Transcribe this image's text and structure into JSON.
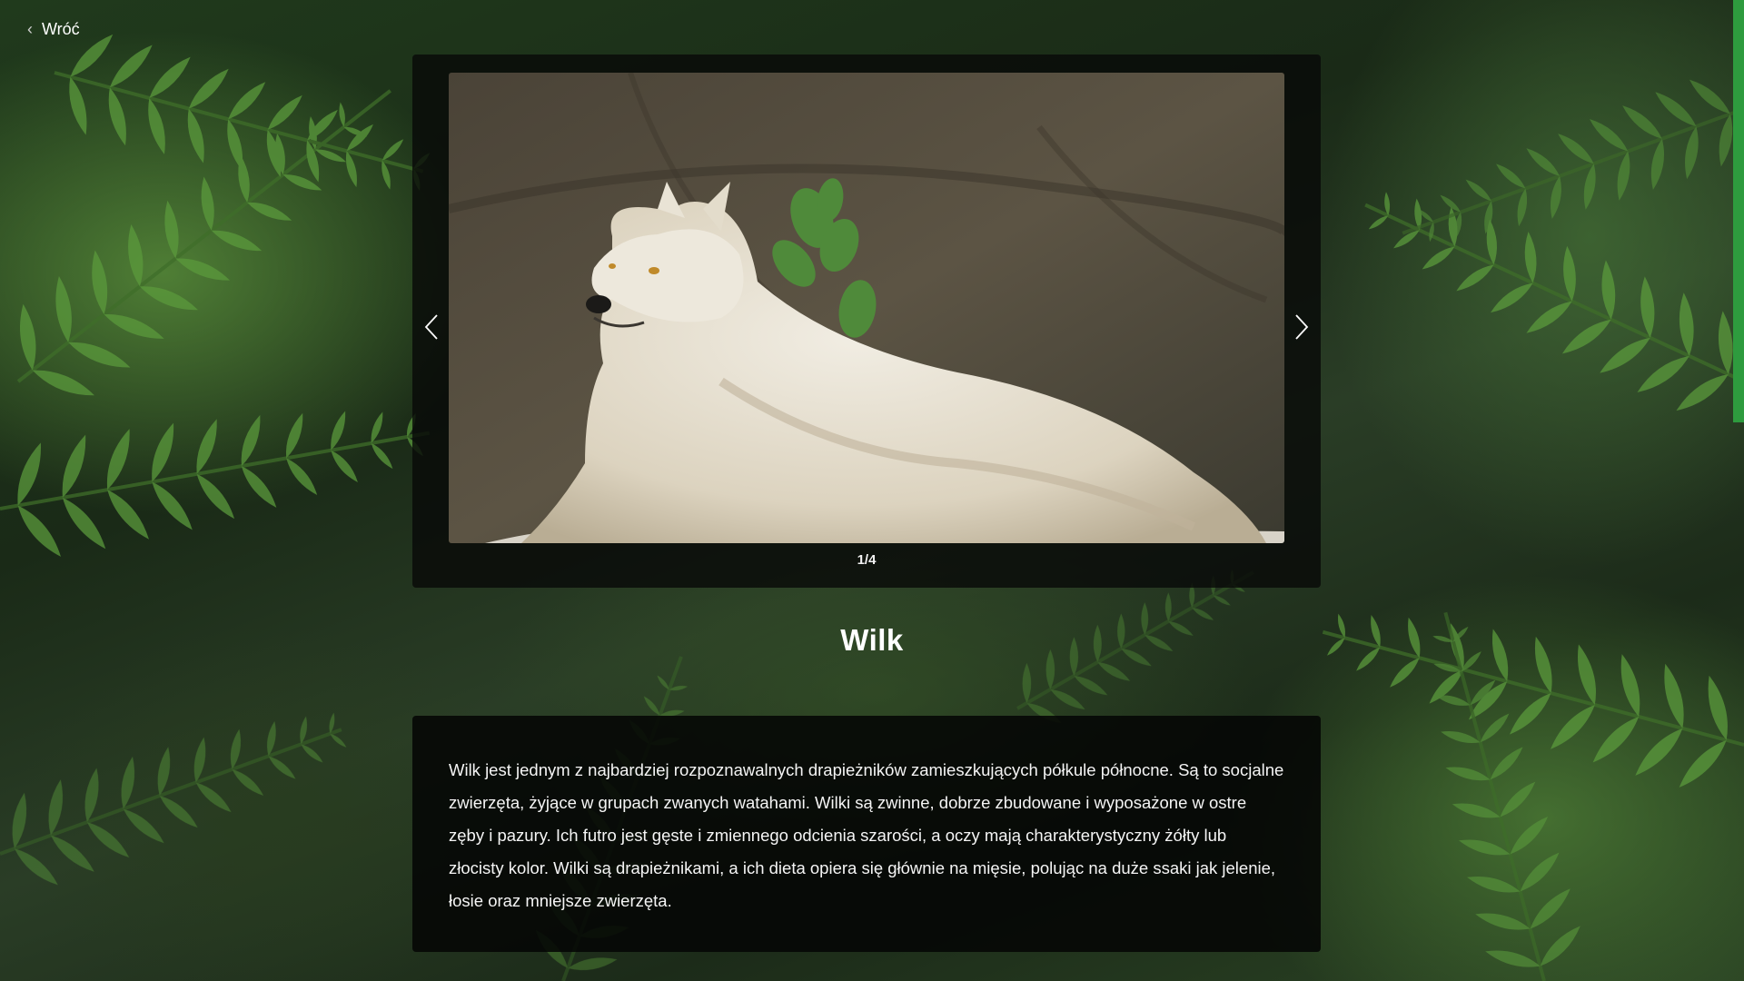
{
  "nav": {
    "back_label": "Wróć"
  },
  "gallery": {
    "counter": "1/4",
    "prev_icon": "chevron-left-icon",
    "next_icon": "chevron-right-icon",
    "current_image": "white wolf lying on a rock"
  },
  "animal": {
    "name": "Wilk",
    "description": "Wilk jest jednym z najbardziej rozpoznawalnych drapieżników zamieszkujących półkule północne. Są to socjalne zwierzęta, żyjące w grupach zwanych watahami. Wilki są zwinne, dobrze zbudowane i wyposażone w ostre zęby i pazury. Ich futro jest gęste i zmiennego odcienia szarości, a oczy mają charakterystyczny żółty lub złocisty kolor. Wilki są drapieżnikami, a ich dieta opiera się głównie na mięsie, polując na duże ssaki jak jelenie, łosie oraz mniejsze zwierzęta."
  },
  "colors": {
    "accent": "#2e9b3e",
    "panel": "#080a08"
  }
}
